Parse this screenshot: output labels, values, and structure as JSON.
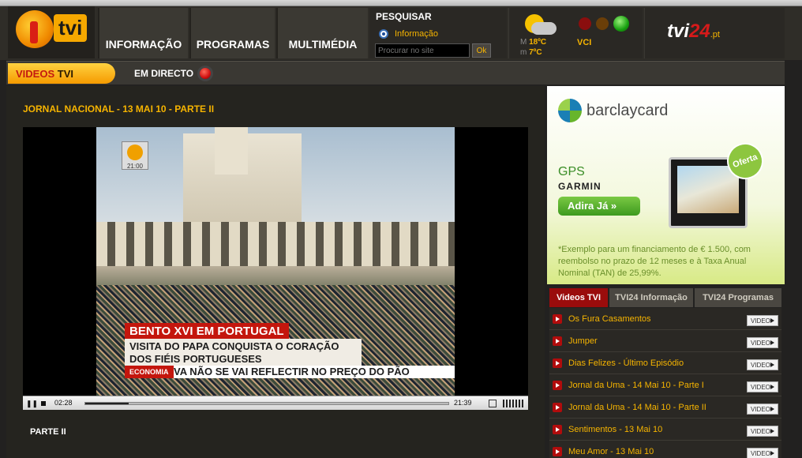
{
  "header": {
    "logo_text": "tvi",
    "nav": [
      "INFORMAÇÃO",
      "PROGRAMAS",
      "MULTIMÉDIA"
    ],
    "search": {
      "title": "PESQUISAR",
      "radio_label": "Informação",
      "placeholder": "Procurar no site",
      "button": "Ok"
    },
    "weather": {
      "max_prefix": "M",
      "max_temp": "18ºC",
      "min_prefix": "m",
      "min_temp": "7ºC",
      "traffic_label": "VCI"
    },
    "brand": {
      "tvi": "tvi",
      "num": "24",
      "tld": ".pt"
    }
  },
  "subnav": {
    "videos_prefix": "VIDEOS",
    "videos_suffix": "TVI",
    "live_label": "EM DIRECTO"
  },
  "main": {
    "video_title": "JORNAL NACIONAL - 13 MAI 10 - PARTE II",
    "overlay": {
      "bug_time": "21:00",
      "headline": "BENTO XVI EM PORTUGAL",
      "subline": "VISITA DO PAPA CONQUISTA O CORAÇÃO DOS FIÉIS PORTUGUESES",
      "ticker_label": "ECONOMIA",
      "ticker_text": "VA NÃO SE VAI REFLECTIR NO PREÇO DO PÃO"
    },
    "player": {
      "current_time": "02:28",
      "total_time": "21:39",
      "progress": 0.12
    },
    "part_label": "PARTE II"
  },
  "ad": {
    "brand": "barclaycard",
    "product": "GPS",
    "maker": "GARMIN",
    "cta": "Adira Já »",
    "badge": "Oferta",
    "fine_print": "*Exemplo para um financiamento de € 1.500, com reembolso no prazo de 12 meses e à Taxa Anual Nominal (TAN) de 25,99%."
  },
  "sidebar": {
    "tabs": [
      "Videos TVI",
      "TVI24 Informação",
      "TVI24 Programas"
    ],
    "video_button": "VIDEO",
    "items": [
      "Os Fura Casamentos",
      "Jumper",
      "Dias Felizes - Último Episódio",
      "Jornal da Uma - 14 Mai 10 - Parte I",
      "Jornal da Uma - 14 Mai 10 - Parte II",
      "Sentimentos - 13 Mai 10",
      "Meu Amor - 13 Mai 10"
    ]
  }
}
